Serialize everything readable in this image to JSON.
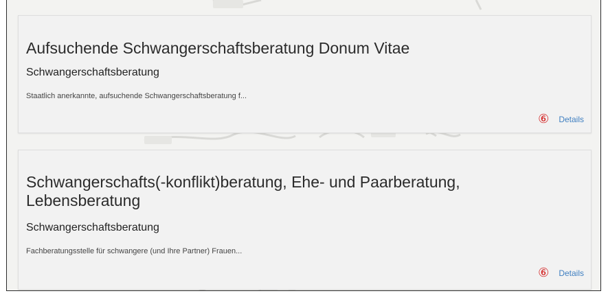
{
  "results": [
    {
      "title": "Aufsuchende Schwangerschaftsberatung Donum Vitae",
      "category": "Schwangerschaftsberatung",
      "description": "Staatlich anerkannte, aufsuchende Schwangerschaftsberatung f...",
      "step_marker": "⑥",
      "details_label": "Details"
    },
    {
      "title": "Schwangerschafts(-konflikt)beratung, Ehe- und Paarberatung, Lebensberatung",
      "category": "Schwangerschaftsberatung",
      "description": "Fachberatungsstelle für schwangere (und Ihre Partner) Frauen...",
      "step_marker": "⑥",
      "details_label": "Details"
    }
  ],
  "colors": {
    "link": "#3f7fc1",
    "step_marker": "#d32020",
    "card_background": "#f2f2f2",
    "text": "#2b2b2b"
  }
}
